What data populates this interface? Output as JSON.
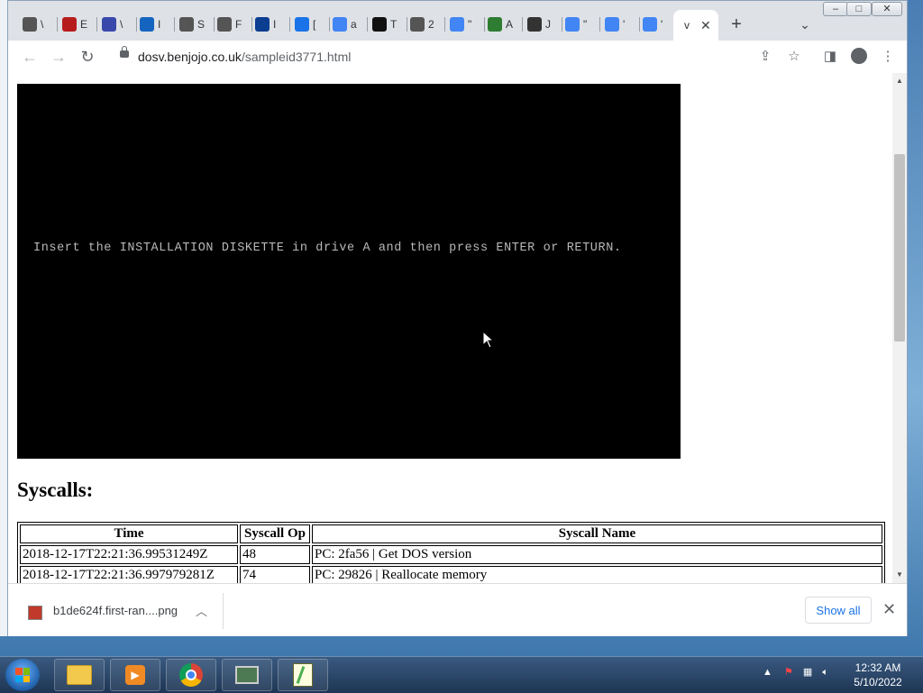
{
  "browser": {
    "tabs": [
      {
        "icon": "vb-icon",
        "label": "\\",
        "color": "#555"
      },
      {
        "icon": "red-square-icon",
        "label": "E",
        "color": "#b71c1c"
      },
      {
        "icon": "sigma-icon",
        "label": "\\",
        "color": "#3949ab"
      },
      {
        "icon": "play-icon",
        "label": "I",
        "color": "#1565c0"
      },
      {
        "icon": "globe-icon",
        "label": "S",
        "color": "#555"
      },
      {
        "icon": "globe-icon",
        "label": "F",
        "color": "#555"
      },
      {
        "icon": "nasa-icon",
        "label": "I",
        "color": "#0b3d91"
      },
      {
        "icon": "download-icon",
        "label": "[",
        "color": "#1a73e8"
      },
      {
        "icon": "google-icon",
        "label": "a",
        "color": "#4285f4"
      },
      {
        "icon": "mountain-icon",
        "label": "T",
        "color": "#111"
      },
      {
        "icon": "globe-icon",
        "label": "2",
        "color": "#555"
      },
      {
        "icon": "google-icon",
        "label": "\"",
        "color": "#4285f4"
      },
      {
        "icon": "abc-icon",
        "label": "A",
        "color": "#2e7d32"
      },
      {
        "icon": "question-icon",
        "label": "J",
        "color": "#333"
      },
      {
        "icon": "google-icon",
        "label": "\"",
        "color": "#4285f4"
      },
      {
        "icon": "google-icon",
        "label": "'",
        "color": "#4285f4"
      },
      {
        "icon": "google-icon",
        "label": "'",
        "color": "#4285f4"
      }
    ],
    "active_tab_label": "v",
    "address": {
      "domain": "dosv.benjojo.co.uk",
      "path": "/sampleid3771.html"
    }
  },
  "page": {
    "dos_screen_text": "Insert the INSTALLATION DISKETTE in drive A and then press ENTER or RETURN.",
    "syscalls_heading": "Syscalls:",
    "table": {
      "headers": [
        "Time",
        "Syscall Op",
        "Syscall Name"
      ],
      "rows": [
        [
          "2018-12-17T22:21:36.99531249Z",
          "48",
          "PC: 2fa56 | Get DOS version"
        ],
        [
          "2018-12-17T22:21:36.997979281Z",
          "74",
          "PC: 29826 | Reallocate memory"
        ]
      ]
    }
  },
  "downloads": {
    "file_name": "b1de624f.first-ran....png",
    "show_all_label": "Show all"
  },
  "taskbar": {
    "clock_time": "12:32 AM",
    "clock_date": "5/10/2022"
  }
}
